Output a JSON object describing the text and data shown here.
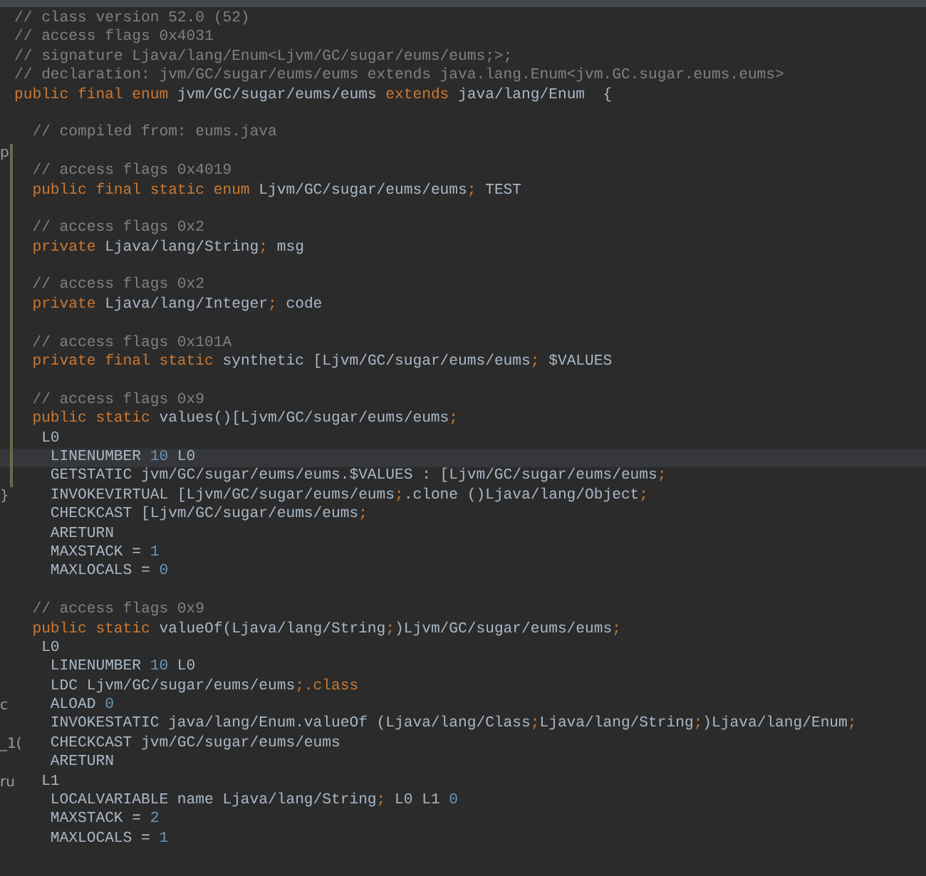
{
  "lines": [
    {
      "kind": "code",
      "current": false,
      "modified": false,
      "tokens": [
        {
          "kind": "comment",
          "text": "// class version 52.0 (52)"
        }
      ]
    },
    {
      "kind": "code",
      "current": false,
      "modified": false,
      "tokens": [
        {
          "kind": "comment",
          "text": "// access flags 0x4031"
        }
      ]
    },
    {
      "kind": "code",
      "current": false,
      "modified": false,
      "tokens": [
        {
          "kind": "comment",
          "text": "// signature Ljava/lang/Enum<Ljvm/GC/sugar/eums/eums;>;"
        }
      ]
    },
    {
      "kind": "code",
      "current": false,
      "modified": false,
      "tokens": [
        {
          "kind": "comment",
          "text": "// declaration: jvm/GC/sugar/eums/eums extends java.lang.Enum<jvm.GC.sugar.eums.eums>"
        }
      ]
    },
    {
      "kind": "code",
      "current": false,
      "modified": false,
      "tokens": [
        {
          "kind": "keyword",
          "text": "public final enum"
        },
        {
          "kind": "text",
          "text": " jvm/GC/sugar/eums/eums "
        },
        {
          "kind": "keyword",
          "text": "extends"
        },
        {
          "kind": "text",
          "text": " java/lang/Enum  {"
        }
      ]
    },
    {
      "kind": "blank",
      "current": false,
      "modified": false
    },
    {
      "kind": "code",
      "current": false,
      "modified": false,
      "tokens": [
        {
          "kind": "comment",
          "text": "  // compiled from: eums.java"
        }
      ]
    },
    {
      "kind": "blank",
      "current": false,
      "modified": true,
      "margin": "p"
    },
    {
      "kind": "code",
      "current": false,
      "modified": true,
      "tokens": [
        {
          "kind": "comment",
          "text": "  // access flags 0x4019"
        }
      ]
    },
    {
      "kind": "code",
      "current": false,
      "modified": true,
      "tokens": [
        {
          "kind": "keyword",
          "text": "  public final static enum"
        },
        {
          "kind": "text",
          "text": " Ljvm/GC/sugar/eums/eums"
        },
        {
          "kind": "keyword",
          "text": ";"
        },
        {
          "kind": "text",
          "text": " TEST"
        }
      ]
    },
    {
      "kind": "blank",
      "current": false,
      "modified": true
    },
    {
      "kind": "code",
      "current": false,
      "modified": true,
      "tokens": [
        {
          "kind": "comment",
          "text": "  // access flags 0x2"
        }
      ]
    },
    {
      "kind": "code",
      "current": false,
      "modified": true,
      "tokens": [
        {
          "kind": "keyword",
          "text": "  private"
        },
        {
          "kind": "text",
          "text": " Ljava/lang/String"
        },
        {
          "kind": "keyword",
          "text": ";"
        },
        {
          "kind": "text",
          "text": " msg"
        }
      ]
    },
    {
      "kind": "blank",
      "current": false,
      "modified": true
    },
    {
      "kind": "code",
      "current": false,
      "modified": true,
      "tokens": [
        {
          "kind": "comment",
          "text": "  // access flags 0x2"
        }
      ]
    },
    {
      "kind": "code",
      "current": false,
      "modified": true,
      "tokens": [
        {
          "kind": "keyword",
          "text": "  private"
        },
        {
          "kind": "text",
          "text": " Ljava/lang/Integer"
        },
        {
          "kind": "keyword",
          "text": ";"
        },
        {
          "kind": "text",
          "text": " code"
        }
      ]
    },
    {
      "kind": "blank",
      "current": false,
      "modified": true
    },
    {
      "kind": "code",
      "current": false,
      "modified": true,
      "tokens": [
        {
          "kind": "comment",
          "text": "  // access flags 0x101A"
        }
      ]
    },
    {
      "kind": "code",
      "current": false,
      "modified": true,
      "tokens": [
        {
          "kind": "keyword",
          "text": "  private final static"
        },
        {
          "kind": "text",
          "text": " synthetic [Ljvm/GC/sugar/eums/eums"
        },
        {
          "kind": "keyword",
          "text": ";"
        },
        {
          "kind": "text",
          "text": " $VALUES"
        }
      ]
    },
    {
      "kind": "blank",
      "current": false,
      "modified": true
    },
    {
      "kind": "code",
      "current": false,
      "modified": true,
      "tokens": [
        {
          "kind": "comment",
          "text": "  // access flags 0x9"
        }
      ]
    },
    {
      "kind": "code",
      "current": false,
      "modified": true,
      "tokens": [
        {
          "kind": "keyword",
          "text": "  public static"
        },
        {
          "kind": "text",
          "text": " values()[Ljvm/GC/sugar/eums/eums"
        },
        {
          "kind": "keyword",
          "text": ";"
        }
      ]
    },
    {
      "kind": "code",
      "current": false,
      "modified": true,
      "tokens": [
        {
          "kind": "text",
          "text": "   L0"
        }
      ]
    },
    {
      "kind": "code",
      "current": true,
      "modified": true,
      "tokens": [
        {
          "kind": "text",
          "text": "    LINENUMBER "
        },
        {
          "kind": "number",
          "text": "10"
        },
        {
          "kind": "text",
          "text": " L0"
        }
      ]
    },
    {
      "kind": "code",
      "current": false,
      "modified": true,
      "tokens": [
        {
          "kind": "text",
          "text": "    GETSTATIC jvm/GC/sugar/eums/eums.$VALUES : [Ljvm/GC/sugar/eums/eums"
        },
        {
          "kind": "keyword",
          "text": ";"
        }
      ]
    },
    {
      "kind": "code",
      "current": false,
      "modified": false,
      "margin": "}",
      "tokens": [
        {
          "kind": "text",
          "text": "    INVOKEVIRTUAL [Ljvm/GC/sugar/eums/eums"
        },
        {
          "kind": "keyword",
          "text": ";"
        },
        {
          "kind": "text",
          "text": ".clone ()Ljava/lang/Object"
        },
        {
          "kind": "keyword",
          "text": ";"
        }
      ]
    },
    {
      "kind": "code",
      "current": false,
      "modified": false,
      "tokens": [
        {
          "kind": "text",
          "text": "    CHECKCAST [Ljvm/GC/sugar/eums/eums"
        },
        {
          "kind": "keyword",
          "text": ";"
        }
      ]
    },
    {
      "kind": "code",
      "current": false,
      "modified": false,
      "tokens": [
        {
          "kind": "text",
          "text": "    ARETURN"
        }
      ]
    },
    {
      "kind": "code",
      "current": false,
      "modified": false,
      "tokens": [
        {
          "kind": "text",
          "text": "    MAXSTACK = "
        },
        {
          "kind": "number",
          "text": "1"
        }
      ]
    },
    {
      "kind": "code",
      "current": false,
      "modified": false,
      "tokens": [
        {
          "kind": "text",
          "text": "    MAXLOCALS = "
        },
        {
          "kind": "number",
          "text": "0"
        }
      ]
    },
    {
      "kind": "blank",
      "current": false,
      "modified": false
    },
    {
      "kind": "code",
      "current": false,
      "modified": false,
      "tokens": [
        {
          "kind": "comment",
          "text": "  // access flags 0x9"
        }
      ]
    },
    {
      "kind": "code",
      "current": false,
      "modified": false,
      "tokens": [
        {
          "kind": "keyword",
          "text": "  public static"
        },
        {
          "kind": "text",
          "text": " valueOf(Ljava/lang/String"
        },
        {
          "kind": "keyword",
          "text": ";"
        },
        {
          "kind": "text",
          "text": ")Ljvm/GC/sugar/eums/eums"
        },
        {
          "kind": "keyword",
          "text": ";"
        }
      ]
    },
    {
      "kind": "code",
      "current": false,
      "modified": false,
      "tokens": [
        {
          "kind": "text",
          "text": "   L0"
        }
      ]
    },
    {
      "kind": "code",
      "current": false,
      "modified": false,
      "tokens": [
        {
          "kind": "text",
          "text": "    LINENUMBER "
        },
        {
          "kind": "number",
          "text": "10"
        },
        {
          "kind": "text",
          "text": " L0"
        }
      ]
    },
    {
      "kind": "code",
      "current": false,
      "modified": false,
      "tokens": [
        {
          "kind": "text",
          "text": "    LDC Ljvm/GC/sugar/eums/eums"
        },
        {
          "kind": "keyword",
          "text": ";.class"
        }
      ]
    },
    {
      "kind": "code",
      "current": false,
      "modified": false,
      "margin": "c",
      "tokens": [
        {
          "kind": "text",
          "text": "    ALOAD "
        },
        {
          "kind": "number",
          "text": "0"
        }
      ]
    },
    {
      "kind": "code",
      "current": false,
      "modified": false,
      "tokens": [
        {
          "kind": "text",
          "text": "    INVOKESTATIC java/lang/Enum.valueOf (Ljava/lang/Class"
        },
        {
          "kind": "keyword",
          "text": ";"
        },
        {
          "kind": "text",
          "text": "Ljava/lang/String"
        },
        {
          "kind": "keyword",
          "text": ";"
        },
        {
          "kind": "text",
          "text": ")Ljava/lang/Enum"
        },
        {
          "kind": "keyword",
          "text": ";"
        }
      ]
    },
    {
      "kind": "code",
      "current": false,
      "modified": false,
      "margin": "_1(",
      "tokens": [
        {
          "kind": "text",
          "text": "    CHECKCAST jvm/GC/sugar/eums/eums"
        }
      ]
    },
    {
      "kind": "code",
      "current": false,
      "modified": false,
      "tokens": [
        {
          "kind": "text",
          "text": "    ARETURN"
        }
      ]
    },
    {
      "kind": "code",
      "current": false,
      "modified": false,
      "margin": "ru",
      "tokens": [
        {
          "kind": "text",
          "text": "   L1"
        }
      ]
    },
    {
      "kind": "code",
      "current": false,
      "modified": false,
      "tokens": [
        {
          "kind": "text",
          "text": "    LOCALVARIABLE name Ljava/lang/String"
        },
        {
          "kind": "keyword",
          "text": ";"
        },
        {
          "kind": "text",
          "text": " L0 L1 "
        },
        {
          "kind": "number",
          "text": "0"
        }
      ]
    },
    {
      "kind": "code",
      "current": false,
      "modified": false,
      "tokens": [
        {
          "kind": "text",
          "text": "    MAXSTACK = "
        },
        {
          "kind": "number",
          "text": "2"
        }
      ]
    },
    {
      "kind": "code",
      "current": false,
      "modified": false,
      "tokens": [
        {
          "kind": "text",
          "text": "    MAXLOCALS = "
        },
        {
          "kind": "number",
          "text": "1"
        }
      ]
    }
  ]
}
